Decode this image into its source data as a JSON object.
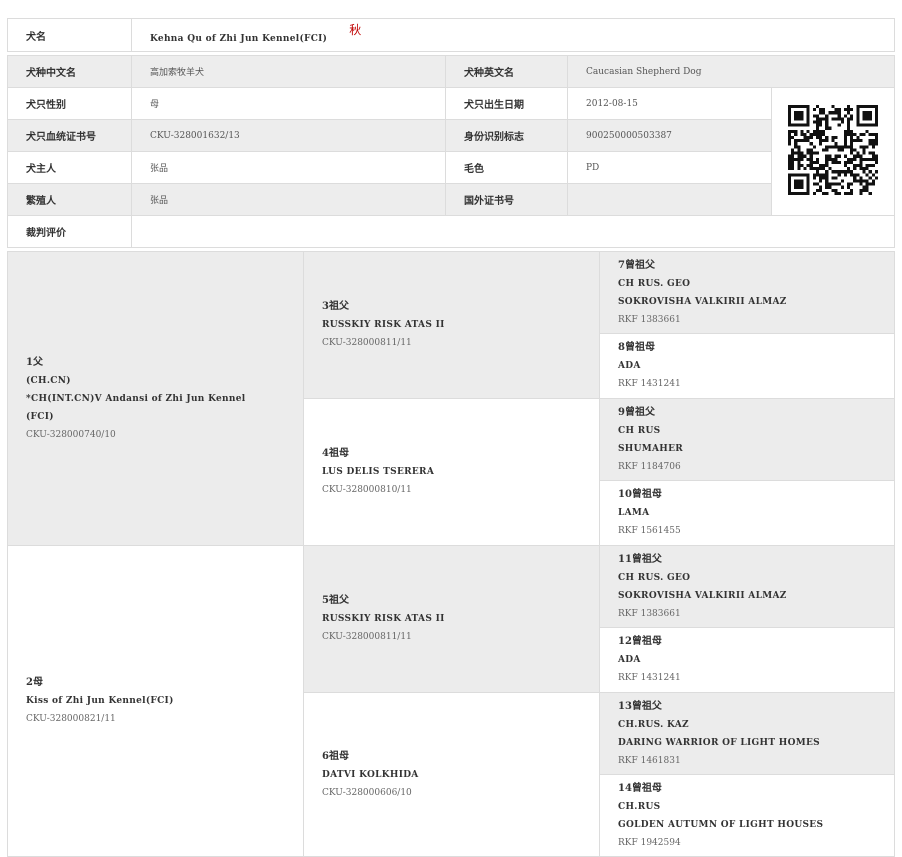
{
  "header": {
    "name_label": "犬名",
    "name_value": "Kehna Qu of Zhi Jun Kennel(FCI)",
    "name_tag": "秋"
  },
  "info": {
    "breed_cn_label": "犬种中文名",
    "breed_cn": "高加索牧羊犬",
    "breed_en_label": "犬种英文名",
    "breed_en": "Caucasian Shepherd Dog",
    "sex_label": "犬只性别",
    "sex": "母",
    "birth_label": "犬只出生日期",
    "birth": "2012-08-15",
    "cert_label": "犬只血统证书号",
    "cert": "CKU-328001632/13",
    "chip_label": "身份识别标志",
    "chip": "900250000503387",
    "owner_label": "犬主人",
    "owner": "张品",
    "color_label": "毛色",
    "color": "PD",
    "breeder_label": "繁殖人",
    "breeder": "张品",
    "foreign_label": "国外证书号",
    "foreign": "",
    "judge_label": "裁判评价",
    "judge": ""
  },
  "pedigree": {
    "parents": [
      {
        "relation": "1父",
        "titles": [
          "(CH.CN)",
          "*CH(INT.CN)V Andansi of Zhi Jun Kennel",
          "(FCI)"
        ],
        "reg": "CKU-328000740/10"
      },
      {
        "relation": "2母",
        "titles": [
          "Kiss of Zhi Jun Kennel(FCI)"
        ],
        "reg": "CKU-328000821/11"
      }
    ],
    "grandparents": [
      {
        "relation": "3祖父",
        "titles": [
          "RUSSKIY RISK ATAS II"
        ],
        "reg": "CKU-328000811/11"
      },
      {
        "relation": "4祖母",
        "titles": [
          "LUS DELIS TSERERA"
        ],
        "reg": "CKU-328000810/11"
      },
      {
        "relation": "5祖父",
        "titles": [
          "RUSSKIY RISK ATAS II"
        ],
        "reg": "CKU-328000811/11"
      },
      {
        "relation": "6祖母",
        "titles": [
          "DATVI KOLKHIDA"
        ],
        "reg": "CKU-328000606/10"
      }
    ],
    "great_grandparents": [
      {
        "relation": "7曾祖父",
        "titles": [
          "CH RUS. GEO",
          "SOKROVISHA VALKIRII ALMAZ"
        ],
        "reg": "RKF 1383661"
      },
      {
        "relation": "8曾祖母",
        "titles": [
          "ADA"
        ],
        "reg": "RKF 1431241"
      },
      {
        "relation": "9曾祖父",
        "titles": [
          "CH RUS",
          "SHUMAHER"
        ],
        "reg": "RKF 1184706"
      },
      {
        "relation": "10曾祖母",
        "titles": [
          "LAMA"
        ],
        "reg": "RKF 1561455"
      },
      {
        "relation": "11曾祖父",
        "titles": [
          "CH RUS. GEO",
          "SOKROVISHA VALKIRII ALMAZ"
        ],
        "reg": "RKF 1383661"
      },
      {
        "relation": "12曾祖母",
        "titles": [
          "ADA"
        ],
        "reg": "RKF 1431241"
      },
      {
        "relation": "13曾祖父",
        "titles": [
          "CH.RUS. KAZ",
          "DARING WARRIOR OF LIGHT HOMES"
        ],
        "reg": "RKF 1461831"
      },
      {
        "relation": "14曾祖母",
        "titles": [
          "CH.RUS",
          "GOLDEN AUTUMN OF LIGHT HOUSES"
        ],
        "reg": "RKF 1942594"
      }
    ]
  }
}
